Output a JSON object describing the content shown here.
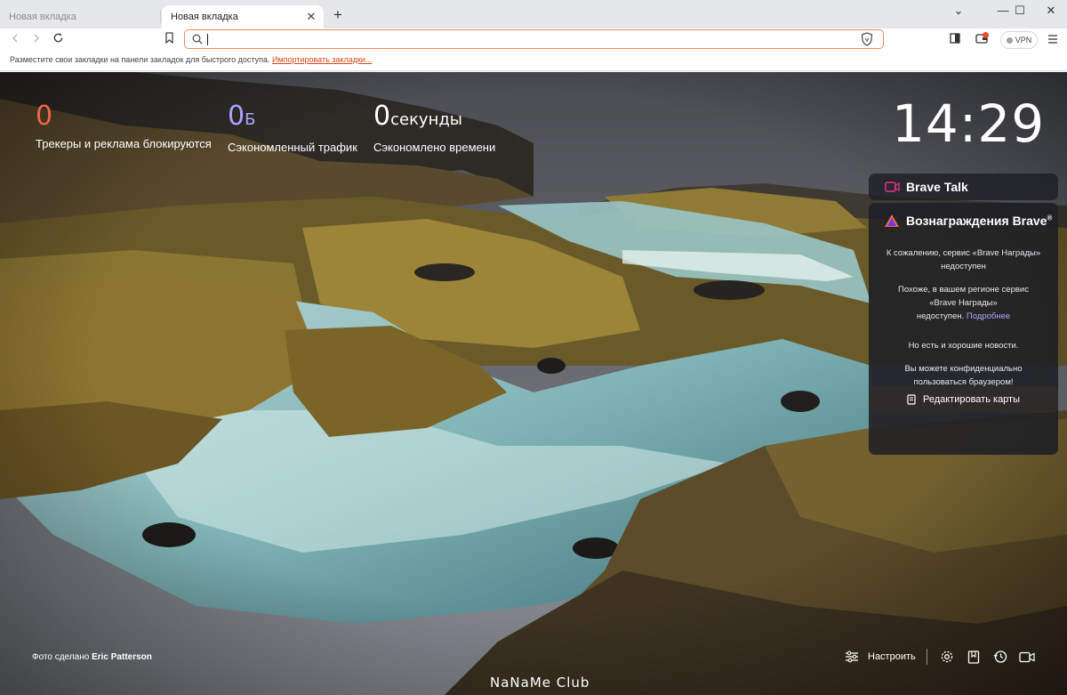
{
  "tabs": [
    {
      "label": "Новая вкладка",
      "active": false
    },
    {
      "label": "Новая вкладка",
      "active": true
    }
  ],
  "window_controls": {
    "menu": "⌄",
    "minimize": "—",
    "maximize": "☐",
    "close": "✕"
  },
  "omnibox": {
    "value": "",
    "placeholder": ""
  },
  "vpn_label": "VPN",
  "bookmarks_bar": {
    "hint": "Разместите свои закладки на панели закладок для быстрого доступа.",
    "import_link": "Импортировать закладки..."
  },
  "stats": [
    {
      "value": "0",
      "unit": "",
      "label": "Трекеры и реклама блокируются",
      "color": "#f0644c"
    },
    {
      "value": "0",
      "unit": "Б",
      "label": "Сэкономленный трафик",
      "color": "#a8a4ff"
    },
    {
      "value": "0",
      "unit": "секунды",
      "label": "Сэкономлено времени",
      "color": "#ffffff"
    }
  ],
  "clock": "14:29",
  "brave_talk": {
    "title": "Brave Talk",
    "icon": "video-camera-icon",
    "accent": "#e5318c"
  },
  "rewards": {
    "title": "Вознаграждения Brave",
    "trademark": "®",
    "icon": "brave-rewards-triangle-icon",
    "p1a": "К сожалению, сервис «Brave Награды»",
    "p1b": "недоступен",
    "p2a": "Похоже, в вашем регионе сервис",
    "p2b": "«Brave Награды»",
    "p2c": "недоступен.",
    "p2_link": "Подробнее",
    "p3": "Но есть и хорошие новости.",
    "p4a": "Вы можете конфиденциально",
    "p4b": "пользоваться браузером!"
  },
  "edit_cards_label": "Редактировать карты",
  "photo_credit": {
    "prefix": "Фото сделано",
    "author": "Eric Patterson"
  },
  "customize_label": "Настроить",
  "watermark": "NaNaMe Club"
}
